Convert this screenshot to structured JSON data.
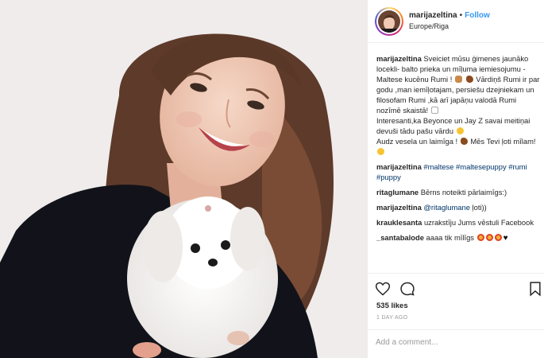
{
  "colors": {
    "link": "#3897f0",
    "hashtag": "#003569",
    "muted": "#999999",
    "text": "#262626"
  },
  "header": {
    "username": "marijazeltina",
    "separator": "•",
    "follow_label": "Follow",
    "location": "Europe/Riga"
  },
  "caption": {
    "username": "marijazeltina",
    "text_1": "Sveiciet mūsu ģimenes jaunāko locekli- balto prieka un mīļuma iemiesojumu -Maltese kucēnu Rumi !",
    "emoji_1": "dog-face-emoji",
    "text_2": "Vārdiņš Rumi ir par godu ,man iemīļotajam, persiešu dzejniekam un filosofam Rumi ,kā arī japāņu valodā Rumi nozīmē skaistā!",
    "emoji_2": "white-heart-emoji",
    "text_3": "Interesanti,ka Beyonce un Jay Z savai meitiņai devuši tādu pašu vārdu",
    "emoji_3": "smile-emoji",
    "text_4": "Audz vesela un laimīga !",
    "text_5": "Mēs Tevi ļoti mīlam!",
    "emoji_5": "smile-emoji"
  },
  "comments": [
    {
      "username": "marijazeltina",
      "tags": "#maltese #maltesepuppy #rumi #puppy"
    },
    {
      "username": "ritaglumane",
      "text": "Bērns noteikti pārlaimīgs:)"
    },
    {
      "username": "marijazeltina",
      "mention": "@ritaglumane",
      "text": "ļoti))"
    },
    {
      "username": "krauklesanta",
      "text": "uzrakstīju Jums vēstuli Facebook"
    },
    {
      "username": "_santabalode",
      "text": "aaaa tik mīlīgs",
      "black_heart": "♥"
    }
  ],
  "actions": {
    "like_icon": "heart-outline-icon",
    "comment_icon": "comment-bubble-icon",
    "save_icon": "bookmark-icon"
  },
  "likes_label": "535 likes",
  "time_label": "1 DAY AGO",
  "comment_input": {
    "placeholder": "Add a comment..."
  }
}
